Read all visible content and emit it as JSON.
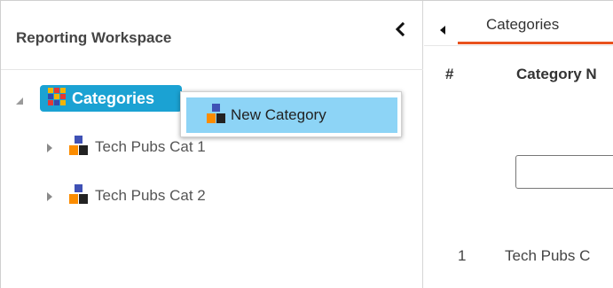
{
  "left_panel": {
    "title": "Reporting Workspace",
    "collapse_icon": "chevron-left-icon"
  },
  "tree": {
    "root": {
      "label": "Categories",
      "icon": "categories-grid-icon",
      "expanded": true,
      "selected": true
    },
    "children": [
      {
        "label": "Tech Pubs Cat 1",
        "icon": "category-icon",
        "expanded": false
      },
      {
        "label": "Tech Pubs Cat 2",
        "icon": "category-icon",
        "expanded": false
      }
    ]
  },
  "context_menu": {
    "items": [
      {
        "label": "New Category",
        "icon": "new-category-icon",
        "highlighted": true
      }
    ]
  },
  "right_panel": {
    "expand_icon": "caret-left-icon",
    "tabs": [
      {
        "label": "Categories",
        "active": true
      }
    ],
    "table": {
      "columns": [
        "#",
        "Category N"
      ],
      "filter_value": "",
      "rows": [
        {
          "num": "1",
          "name": "Tech Pubs C"
        }
      ]
    }
  },
  "colors": {
    "accent": "#1ba2d3",
    "menu_highlight": "#8dd4f6",
    "tab_underline": "#e8521e"
  }
}
